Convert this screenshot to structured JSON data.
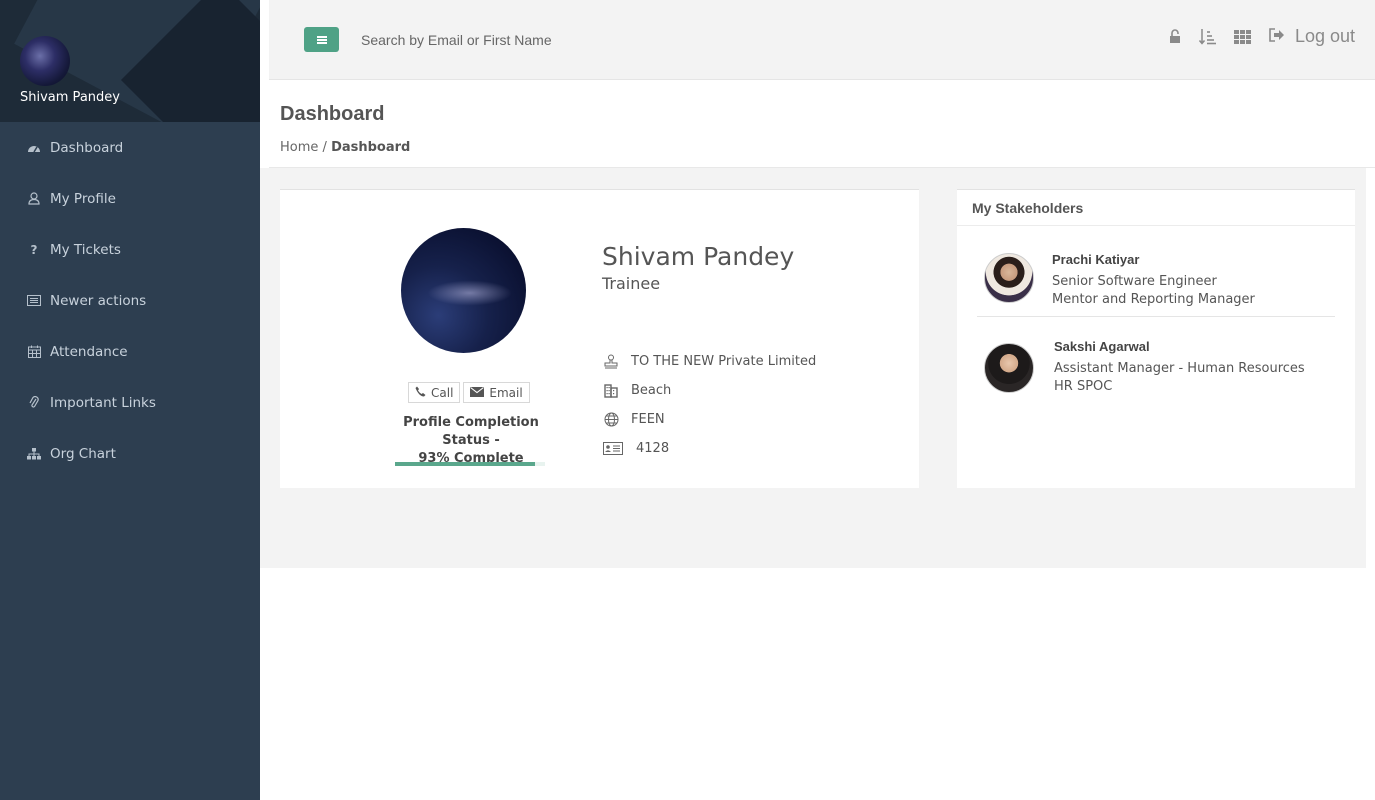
{
  "sidebar": {
    "user_name": "Shivam Pandey",
    "items": [
      {
        "label": "Dashboard",
        "icon": "dashboard-icon"
      },
      {
        "label": "My Profile",
        "icon": "user-icon"
      },
      {
        "label": "My Tickets",
        "icon": "question-icon"
      },
      {
        "label": "Newer actions",
        "icon": "list-icon"
      },
      {
        "label": "Attendance",
        "icon": "calendar-icon"
      },
      {
        "label": "Important Links",
        "icon": "paperclip-icon"
      },
      {
        "label": "Org Chart",
        "icon": "sitemap-icon"
      }
    ]
  },
  "topbar": {
    "search_placeholder": "Search by Email or First Name",
    "logout_label": "Log out",
    "icons": [
      "unlock-icon",
      "sort-icon",
      "grid-icon",
      "logout-icon"
    ],
    "accent": "#4fa286"
  },
  "header": {
    "title": "Dashboard",
    "breadcrumb_home": "Home",
    "breadcrumb_sep": "/",
    "breadcrumb_current": "Dashboard"
  },
  "profile": {
    "name": "Shivam Pandey",
    "role": "Trainee",
    "call_label": "Call",
    "email_label": "Email",
    "completion_line1": "Profile Completion Status -",
    "completion_line2": "93% Complete",
    "completion_percent": 93,
    "company": "TO THE NEW Private Limited",
    "location": "Beach",
    "unit": "FEEN",
    "employee_id": "4128"
  },
  "stakeholders": {
    "title": "My Stakeholders",
    "people": [
      {
        "name": "Prachi Katiyar",
        "line1": "Senior Software Engineer",
        "line2": "Mentor and Reporting Manager"
      },
      {
        "name": "Sakshi Agarwal",
        "line1": "Assistant Manager - Human Resources",
        "line2": "HR SPOC"
      }
    ]
  }
}
